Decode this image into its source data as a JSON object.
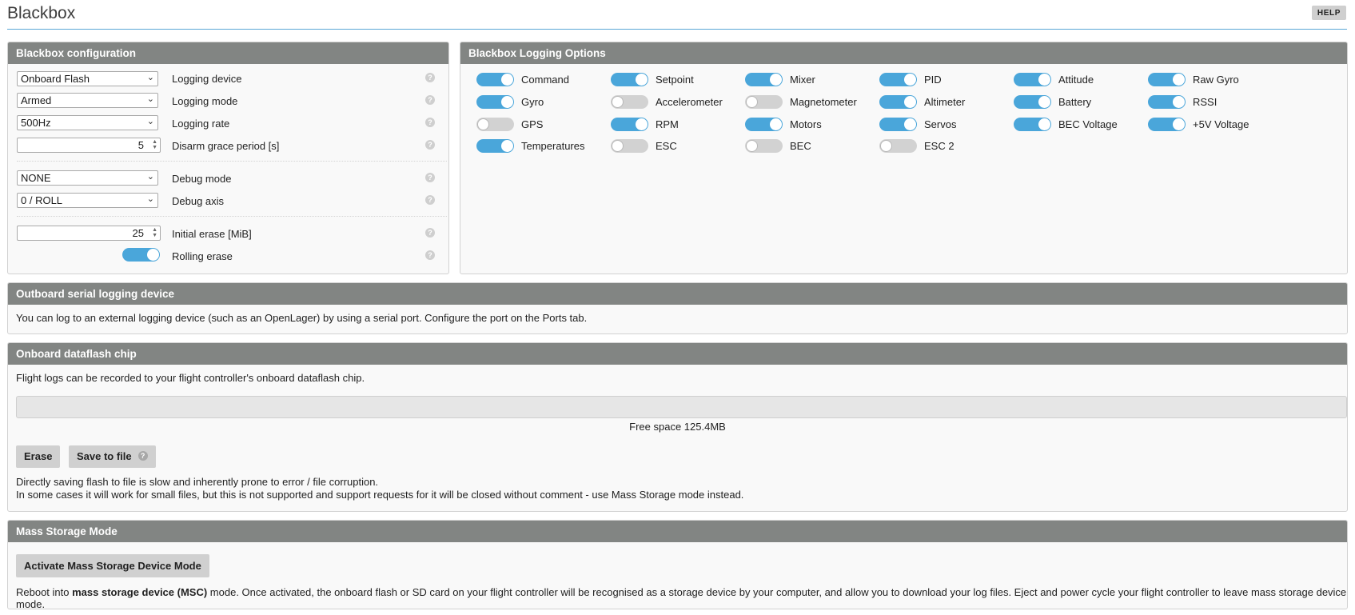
{
  "header": {
    "title": "Blackbox",
    "help_label": "HELP"
  },
  "config": {
    "title": "Blackbox configuration",
    "logging_device": {
      "value": "Onboard Flash",
      "label": "Logging device"
    },
    "logging_mode": {
      "value": "Armed",
      "label": "Logging mode"
    },
    "logging_rate": {
      "value": "500Hz",
      "label": "Logging rate"
    },
    "disarm_grace": {
      "value": "5",
      "label": "Disarm grace period [s]"
    },
    "debug_mode": {
      "value": "NONE",
      "label": "Debug mode"
    },
    "debug_axis": {
      "value": "0 / ROLL",
      "label": "Debug axis"
    },
    "initial_erase": {
      "value": "25",
      "label": "Initial erase [MiB]"
    },
    "rolling_erase": {
      "on": true,
      "label": "Rolling erase"
    },
    "help_glyph": "?"
  },
  "logging_options": {
    "title": "Blackbox Logging Options",
    "items": [
      {
        "label": "Command",
        "on": true
      },
      {
        "label": "Setpoint",
        "on": true
      },
      {
        "label": "Mixer",
        "on": true
      },
      {
        "label": "PID",
        "on": true
      },
      {
        "label": "Attitude",
        "on": true
      },
      {
        "label": "Raw Gyro",
        "on": true
      },
      {
        "label": "Gyro",
        "on": true
      },
      {
        "label": "Accelerometer",
        "on": false
      },
      {
        "label": "Magnetometer",
        "on": false
      },
      {
        "label": "Altimeter",
        "on": true
      },
      {
        "label": "Battery",
        "on": true
      },
      {
        "label": "RSSI",
        "on": true
      },
      {
        "label": "GPS",
        "on": false
      },
      {
        "label": "RPM",
        "on": true
      },
      {
        "label": "Motors",
        "on": true
      },
      {
        "label": "Servos",
        "on": true
      },
      {
        "label": "BEC Voltage",
        "on": true
      },
      {
        "label": "+5V Voltage",
        "on": true
      },
      {
        "label": "Temperatures",
        "on": true
      },
      {
        "label": "ESC",
        "on": false
      },
      {
        "label": "BEC",
        "on": false
      },
      {
        "label": "ESC 2",
        "on": false
      }
    ]
  },
  "outboard": {
    "title": "Outboard serial logging device",
    "text": "You can log to an external logging device (such as an OpenLager) by using a serial port. Configure the port on the Ports tab."
  },
  "dataflash": {
    "title": "Onboard dataflash chip",
    "text": "Flight logs can be recorded to your flight controller's onboard dataflash chip.",
    "used_fraction": 0,
    "free_space": "Free space 125.4MB",
    "erase_label": "Erase",
    "save_label": "Save to file",
    "help_glyph": "?",
    "warning_line1": "Directly saving flash to file is slow and inherently prone to error / file corruption.",
    "warning_line2": "In some cases it will work for small files, but this is not supported and support requests for it will be closed without comment - use Mass Storage mode instead."
  },
  "msc": {
    "title": "Mass Storage Mode",
    "button_label": "Activate Mass Storage Device Mode",
    "text_pre": "Reboot into ",
    "text_bold": "mass storage device (MSC)",
    "text_post": " mode. Once activated, the onboard flash or SD card on your flight controller will be recognised as a storage device by your computer, and allow you to download your log files. Eject and power cycle your flight controller to leave mass storage device mode."
  },
  "colors": {
    "accent": "#4aa6da",
    "panel_header": "#828583",
    "toggle_off": "#d2d2d2"
  }
}
